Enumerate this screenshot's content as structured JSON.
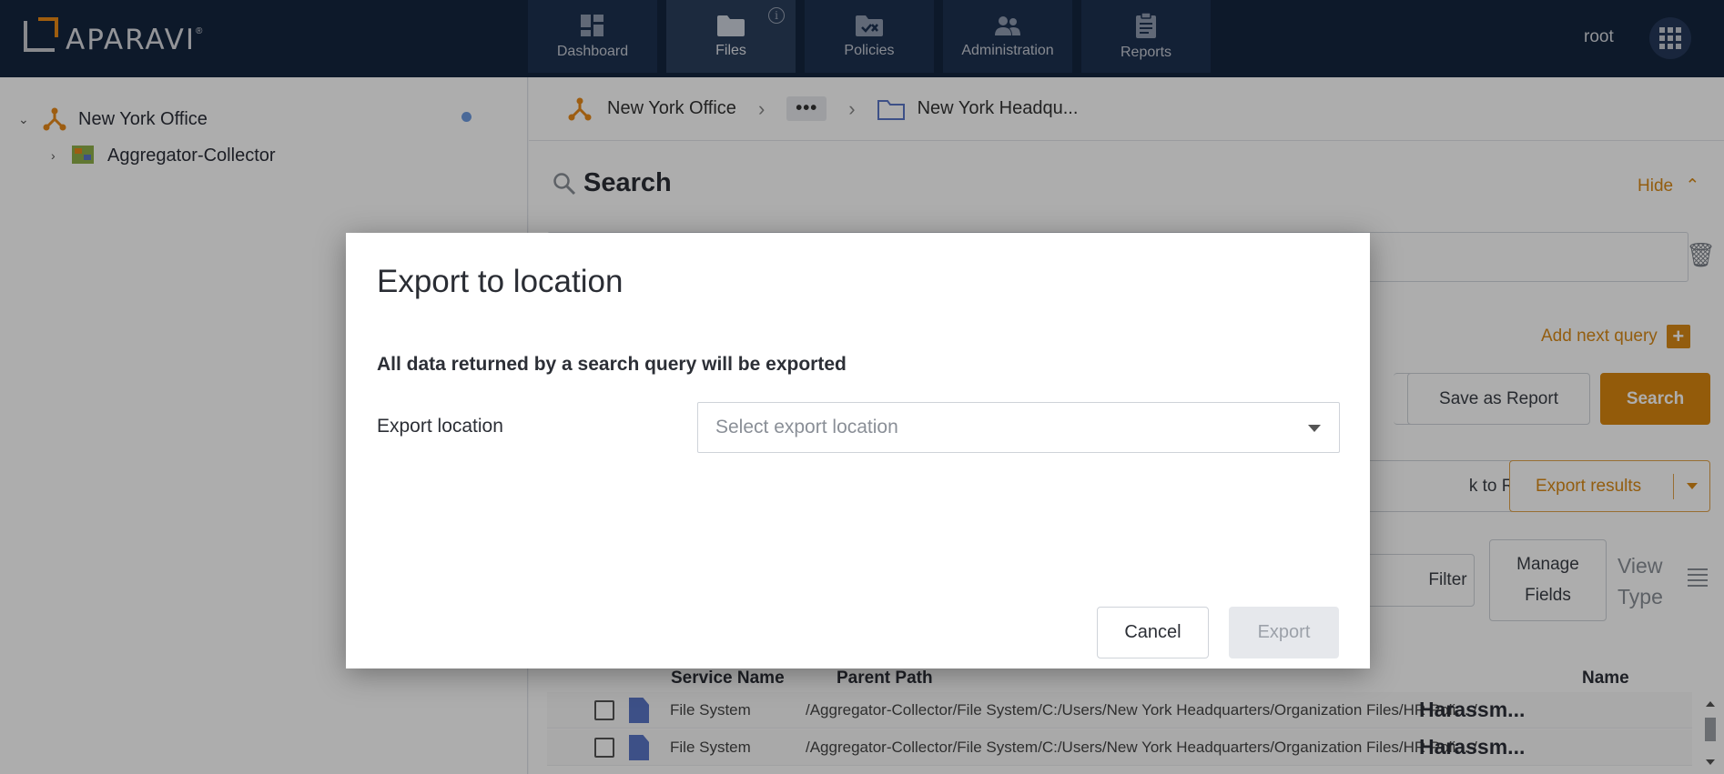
{
  "app": {
    "logo_text": "APARAVI",
    "logo_mark": "®",
    "user": "root"
  },
  "nav": {
    "items": [
      {
        "label": "Dashboard",
        "icon": "dashboard-icon"
      },
      {
        "label": "Files",
        "icon": "folder-icon",
        "active": true,
        "badge": "i"
      },
      {
        "label": "Policies",
        "icon": "policies-icon"
      },
      {
        "label": "Administration",
        "icon": "users-icon"
      },
      {
        "label": "Reports",
        "icon": "clipboard-icon"
      }
    ]
  },
  "sidebar": {
    "tree": [
      {
        "label": "New York Office",
        "icon": "network-node-icon",
        "expanded": true
      },
      {
        "label": "Aggregator-Collector",
        "icon": "collector-icon",
        "expanded": false
      }
    ]
  },
  "breadcrumb": {
    "root": "New York Office",
    "more": "•••",
    "current": "New York Headqu..."
  },
  "search": {
    "title": "Search",
    "hide_label": "Hide",
    "add_query_label": "Add next query",
    "save_report_label": "Save as Report",
    "search_label": "Search",
    "link_results_label": "k to Results",
    "export_results_label": "Export results",
    "filter_label": "Filter",
    "manage_fields_label": "Manage Fields",
    "view_type_label": "View Type"
  },
  "table": {
    "columns": [
      "Service Name",
      "Parent Path",
      "Name"
    ],
    "rows": [
      {
        "service": "File System",
        "path": "/Aggregator-Collector/File System/C:/Users/New York Headquarters/Organization Files/HR Poli... /",
        "name": "Harassm..."
      },
      {
        "service": "File System",
        "path": "/Aggregator-Collector/File System/C:/Users/New York Headquarters/Organization Files/HR Poli... /",
        "name": "Harassm..."
      }
    ]
  },
  "modal": {
    "title": "Export to location",
    "note": "All data returned by a search query will be exported",
    "field_label": "Export location",
    "select_placeholder": "Select export location",
    "cancel_label": "Cancel",
    "export_label": "Export"
  },
  "colors": {
    "topbar": "#14253f",
    "accent": "#d9860f",
    "file_icon": "#5a76c8"
  }
}
